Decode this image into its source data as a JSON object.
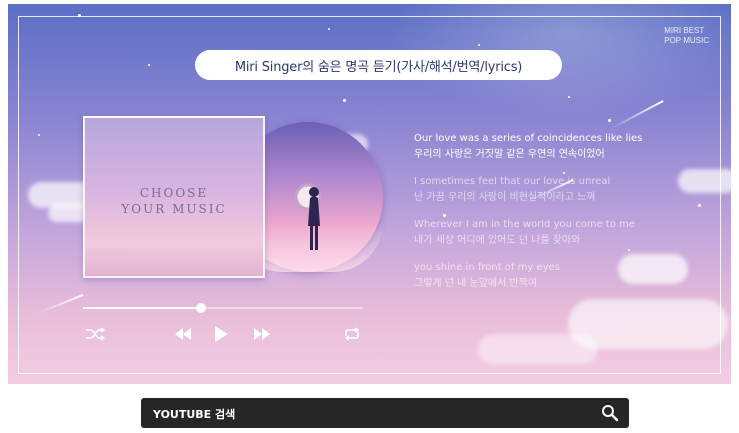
{
  "banner": {
    "title": "Miri Singer의 숨은 명곡 듣기(가사/해석/번역/lyrics)",
    "brand_line1": "MIRI BEST",
    "brand_line2": "POP MUSIC"
  },
  "album": {
    "line1": "CHOOSE",
    "line2": "YOUR MUSIC"
  },
  "lyrics": [
    {
      "en": "Our love was a series of coincidences like lies",
      "ko": "우리의 사랑은 거짓말 같은 우연의 연속이었어",
      "active": true
    },
    {
      "en": "I sometimes feel that our love is unreal",
      "ko": "난 가끔 우리의 사랑이 비현실적이라고 느껴",
      "active": false
    },
    {
      "en": "Wherever I am in the world you come to me",
      "ko": "내가 세상 어디에 있어도 넌 나를 찾아와",
      "active": false
    },
    {
      "en": "you shine in front of my eyes",
      "ko": "그렇게 넌 내 눈앞에서 반짝여",
      "active": false
    }
  ],
  "player": {
    "progress": 0.42,
    "icons": [
      "shuffle-icon",
      "rewind-icon",
      "play-icon",
      "fast-forward-icon",
      "repeat-icon"
    ]
  },
  "search": {
    "placeholder": "YOUTUBE 검색",
    "icon": "search-icon"
  },
  "colors": {
    "title_text": "#2e3674",
    "search_bg": "#262626"
  }
}
